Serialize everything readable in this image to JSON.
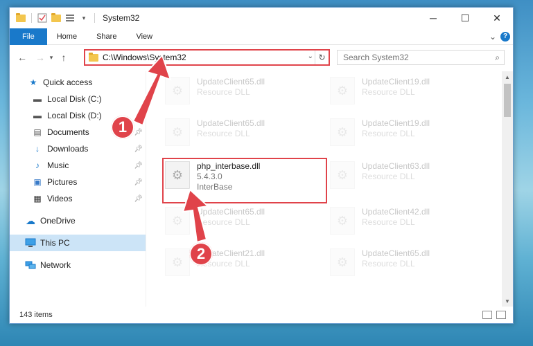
{
  "window": {
    "title": "System32",
    "controls": {
      "minimize": "─",
      "maximize": "☐",
      "close": "✕"
    }
  },
  "ribbon": {
    "tabs": [
      "File",
      "Home",
      "Share",
      "View"
    ],
    "expand": "⌄",
    "help": "?"
  },
  "address": {
    "path": "C:\\Windows\\System32",
    "dropdown": "⌄",
    "refresh": "↻"
  },
  "search": {
    "placeholder": "Search System32"
  },
  "sidebar": {
    "items": [
      {
        "label": "Quick access",
        "icon": "star-icon",
        "glyph": "★",
        "color": "#1979ca"
      },
      {
        "label": "Local Disk (C:)",
        "icon": "drive-icon",
        "glyph": "▬",
        "color": "#555555"
      },
      {
        "label": "Local Disk (D:)",
        "icon": "drive-icon",
        "glyph": "▬",
        "color": "#555555"
      },
      {
        "label": "Documents",
        "icon": "documents-icon",
        "glyph": "▤",
        "color": "#555555"
      },
      {
        "label": "Downloads",
        "icon": "downloads-icon",
        "glyph": "↓",
        "color": "#1979ca"
      },
      {
        "label": "Music",
        "icon": "music-icon",
        "glyph": "♪",
        "color": "#1979ca"
      },
      {
        "label": "Pictures",
        "icon": "pictures-icon",
        "glyph": "▣",
        "color": "#3a7bc8"
      },
      {
        "label": "Videos",
        "icon": "videos-icon",
        "glyph": "▦",
        "color": "#333333"
      },
      {
        "label": "OneDrive",
        "icon": "cloud-icon",
        "glyph": "☁",
        "color": "#1979ca"
      },
      {
        "label": "This PC",
        "icon": "computer-icon",
        "glyph": "▭",
        "color": "#1979ca"
      },
      {
        "label": "Network",
        "icon": "network-icon",
        "glyph": "⇄",
        "color": "#1979ca"
      }
    ]
  },
  "files": {
    "left": [
      {
        "name": "UpdateClient65.dll",
        "sub1": "Resource DLL",
        "sub2": ""
      },
      {
        "name": "UpdateClient65.dll",
        "sub1": "Resource DLL",
        "sub2": ""
      },
      {
        "name": "php_interbase.dll",
        "sub1": "5.4.3.0",
        "sub2": "InterBase"
      },
      {
        "name": "UpdateClient65.dll",
        "sub1": "Resource DLL",
        "sub2": ""
      },
      {
        "name": "UpdateClient21.dll",
        "sub1": "Resource DLL",
        "sub2": ""
      }
    ],
    "right": [
      {
        "name": "UpdateClient19.dll",
        "sub1": "Resource DLL"
      },
      {
        "name": "UpdateClient19.dll",
        "sub1": "Resource DLL"
      },
      {
        "name": "UpdateClient63.dll",
        "sub1": "Resource DLL"
      },
      {
        "name": "UpdateClient42.dll",
        "sub1": "Resource DLL"
      },
      {
        "name": "UpdateClient65.dll",
        "sub1": "Resource DLL"
      }
    ]
  },
  "annotations": {
    "step1": "1",
    "step2": "2"
  },
  "status": {
    "count": "143 items"
  }
}
